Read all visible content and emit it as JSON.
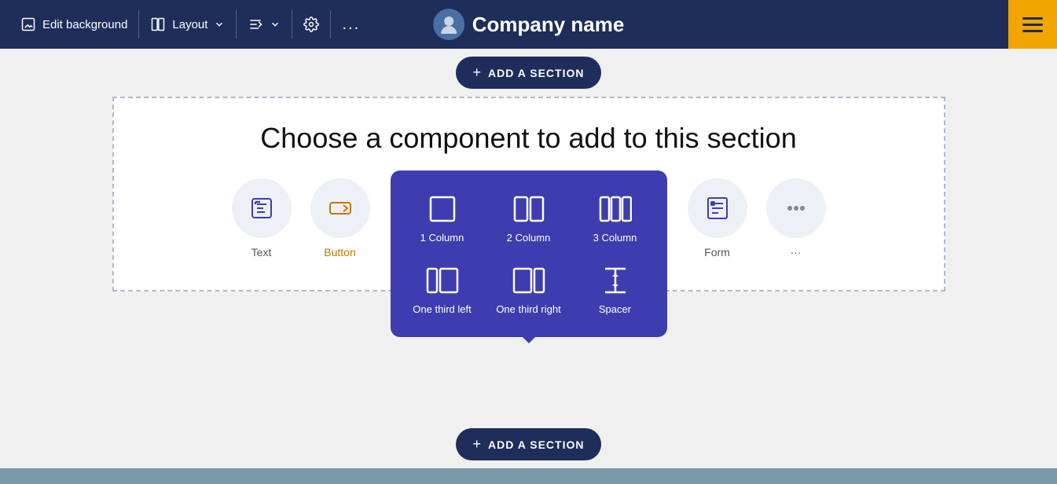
{
  "toolbar": {
    "edit_background_label": "Edit background",
    "layout_label": "Layout",
    "settings_label": "Settings",
    "more_label": "...",
    "company_name": "Company name"
  },
  "add_section": {
    "label": "ADD A SECTION"
  },
  "section": {
    "title": "Choose a component to add to this section"
  },
  "components": [
    {
      "id": "text",
      "label": "Text"
    },
    {
      "id": "button",
      "label": "Button"
    },
    {
      "id": "form",
      "label": "Form"
    },
    {
      "id": "more",
      "label": "..."
    }
  ],
  "layout_options": [
    {
      "id": "one-column",
      "label": "1 Column"
    },
    {
      "id": "two-column",
      "label": "2 Column"
    },
    {
      "id": "three-column",
      "label": "3 Column"
    },
    {
      "id": "one-third-left",
      "label": "One third left"
    },
    {
      "id": "one-third-right",
      "label": "One third right"
    },
    {
      "id": "spacer",
      "label": "Spacer"
    }
  ],
  "colors": {
    "toolbar_bg": "#1e2d5a",
    "popup_bg": "#3d3db0",
    "hamburger_bg": "#f0a500"
  }
}
